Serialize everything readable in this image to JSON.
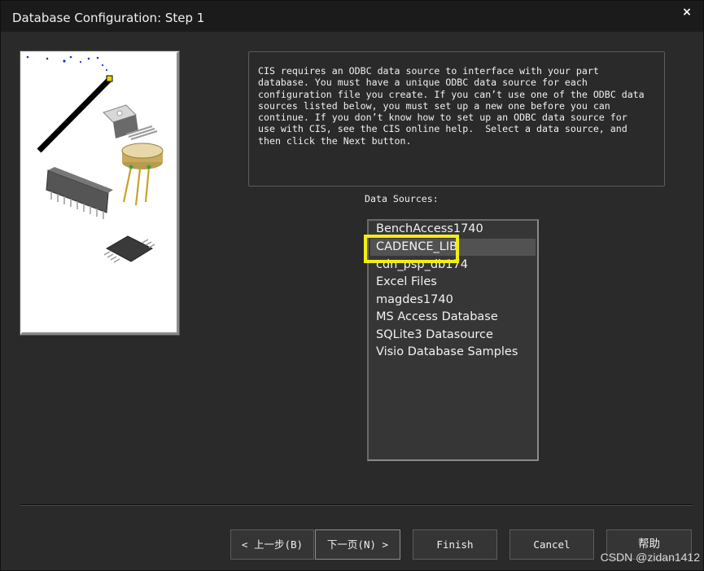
{
  "window": {
    "title": "Database Configuration: Step 1",
    "close_glyph": "×"
  },
  "description": "CIS requires an ODBC data source to interface with your part\ndatabase. You must have a unique ODBC data source for each\nconfiguration file you create. If you can’t use one of the ODBC data\nsources listed below, you must set up a new one before you can\ncontinue. If you don’t know how to set up an ODBC data source for\nuse with CIS, see the CIS online help.  Select a data source, and\nthen click the Next button.",
  "data_sources": {
    "label": "Data Sources:",
    "items": [
      {
        "label": "BenchAccess1740",
        "selected": false
      },
      {
        "label": "CADENCE_LIB",
        "selected": true
      },
      {
        "label": "cdn_psp_db174",
        "selected": false
      },
      {
        "label": "Excel Files",
        "selected": false
      },
      {
        "label": "magdes1740",
        "selected": false
      },
      {
        "label": "MS Access Database",
        "selected": false
      },
      {
        "label": "SQLite3 Datasource",
        "selected": false
      },
      {
        "label": "Visio Database Samples",
        "selected": false
      }
    ],
    "highlight_color": "#f2ee15"
  },
  "buttons": {
    "back": "< 上一步(B)",
    "next": "下一页(N) >",
    "finish": "Finish",
    "cancel": "Cancel",
    "help": "帮助"
  },
  "watermark": "CSDN @zidan1412",
  "illustration": {
    "icons": [
      "probe-icon",
      "to220-transistor-icon",
      "to5-can-icon",
      "dip-chip-icon",
      "soic-chip-icon"
    ]
  },
  "colors": {
    "window_bg": "#2a2a2a",
    "titlebar_bg": "#1b1b1b",
    "selected_item_bg": "#525252"
  }
}
